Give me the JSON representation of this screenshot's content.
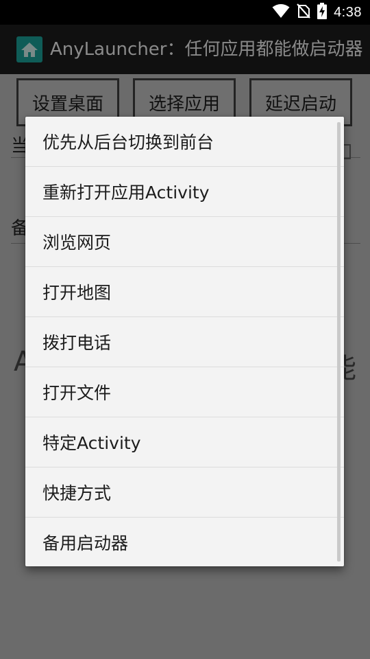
{
  "status_bar": {
    "time": "4:38",
    "icons": [
      "wifi-icon",
      "no-sim-icon",
      "battery-charging-icon"
    ]
  },
  "action_bar": {
    "app_icon": "home-icon",
    "title": "AnyLauncher：任何应用都能做启动器"
  },
  "toolbar": {
    "set_desktop_label": "设置桌面",
    "select_app_label": "选择应用",
    "delay_start_label": "延迟启动"
  },
  "background": {
    "line1_prefix": "当",
    "line2_prefix": "备",
    "big_text_left": "A",
    "big_text_right": "能"
  },
  "popup_menu": {
    "items": [
      "优先从后台切换到前台",
      "重新打开应用Activity",
      "浏览网页",
      "打开地图",
      "拨打电话",
      "打开文件",
      "特定Activity",
      "快捷方式",
      "备用启动器"
    ]
  },
  "colors": {
    "status_bar": "#000000",
    "action_bar": "#101010",
    "scrim": "#6b6b6b",
    "popup_bg": "#f3f3f3",
    "app_icon_bg": "#0f5c57"
  }
}
